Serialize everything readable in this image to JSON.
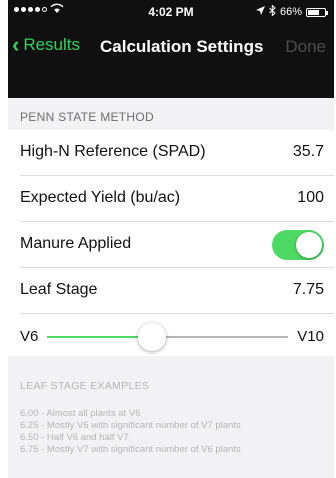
{
  "status_bar": {
    "carrier_signal": "●●●●○",
    "wifi_icon": "wifi-icon",
    "time": "4:02 PM",
    "location_icon": "location-arrow-icon",
    "bluetooth_icon": "bluetooth-icon",
    "battery_percent": "66%",
    "battery_level": 0.66
  },
  "nav": {
    "back_label": "Results",
    "title": "Calculation Settings",
    "done_label": "Done"
  },
  "section": {
    "header": "PENN STATE METHOD"
  },
  "rows": [
    {
      "label": "High-N Reference (SPAD)",
      "value": "35.7"
    },
    {
      "label": "Expected Yield (bu/ac)",
      "value": "100"
    },
    {
      "label": "Manure Applied",
      "toggle_on": true
    },
    {
      "label": "Leaf Stage",
      "value": "7.75"
    }
  ],
  "slider": {
    "min_label": "V6",
    "max_label": "V10",
    "min": 6,
    "max": 10,
    "value": 7.75
  },
  "footer": {
    "title": "LEAF STAGE EXAMPLES",
    "items": [
      "6.00 - Almost all plants at V6",
      "6.25 - Mostly V6 with significant number of V7 plants",
      "6.50 - Half V6 and half V7",
      "6.75 - Mostly V7 with significant number of V6 plants"
    ]
  },
  "colors": {
    "accent": "#4cd964",
    "nav_accent": "#2fd55a",
    "nav_bg": "#101010",
    "done_disabled": "#4d4d4d"
  }
}
